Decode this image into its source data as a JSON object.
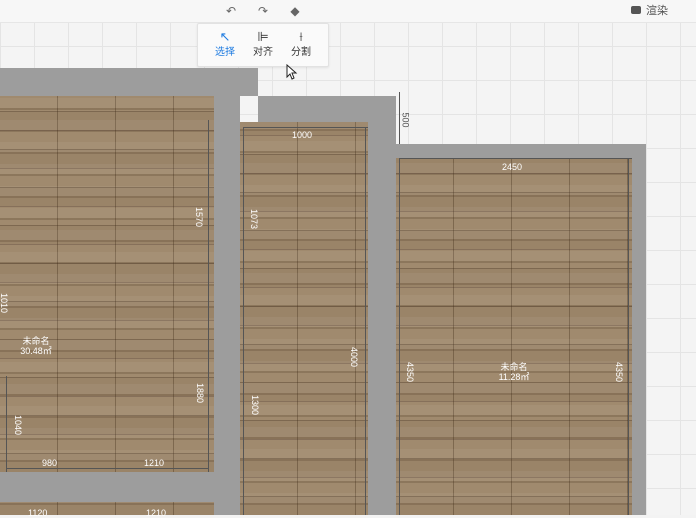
{
  "toolbar": {
    "undo_icon": "undo-arrow-icon",
    "redo_icon": "redo-arrow-icon",
    "eraser_icon": "eraser-icon",
    "render_label": "渲染"
  },
  "tools": [
    {
      "label": "选择",
      "icon": "cursor-arrow-icon",
      "active": true
    },
    {
      "label": "对齐",
      "icon": "align-left-icon",
      "active": false
    },
    {
      "label": "分割",
      "icon": "split-icon",
      "active": false
    }
  ],
  "rooms": [
    {
      "name": "未命名",
      "area": "30.48㎡"
    },
    {
      "name": "未命名",
      "area": "11.28㎡"
    }
  ],
  "dimensions": {
    "d1000_top": "1000",
    "d500": "500",
    "d2450": "2450",
    "d1570": "1570",
    "d1073": "1073",
    "d4000": "4000",
    "d4350_left": "4350",
    "d4350_right": "4350",
    "d980": "980",
    "d1210": "1210",
    "d1880": "1880",
    "d1040": "1040",
    "d1120": "1120",
    "d1300": "1300",
    "d1210_b": "1210",
    "d1010": "1010"
  },
  "accent": "#1e7be0"
}
